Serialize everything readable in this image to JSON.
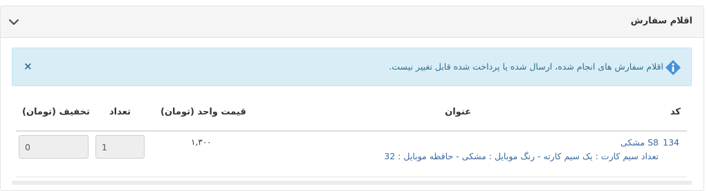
{
  "panel": {
    "title": "اقلام سفارش"
  },
  "alert": {
    "message": "اقلام سفارش های انجام شده، ارسال شده یا پرداخت شده قابل تغییر نیست.",
    "close_symbol": "×"
  },
  "table": {
    "headers": {
      "code": "کد",
      "title": "عنوان",
      "unit_price": "قیمت واحد (تومان)",
      "quantity": "تعداد",
      "discount": "تخفیف (تومان)"
    },
    "rows": [
      {
        "code": "134",
        "title": "S8 مشکی",
        "attributes": "تعداد سیم کارت : یک سیم کارته - رنگ موبایل : مشکی - حافظه موبایل : 32",
        "unit_price": "۱,۳۰۰",
        "quantity": "1",
        "discount": "0"
      }
    ]
  },
  "colors": {
    "alert_bg": "#d9edf7",
    "alert_text": "#31708f",
    "link": "#3d6a9e",
    "info_icon": "#4a90d9"
  }
}
